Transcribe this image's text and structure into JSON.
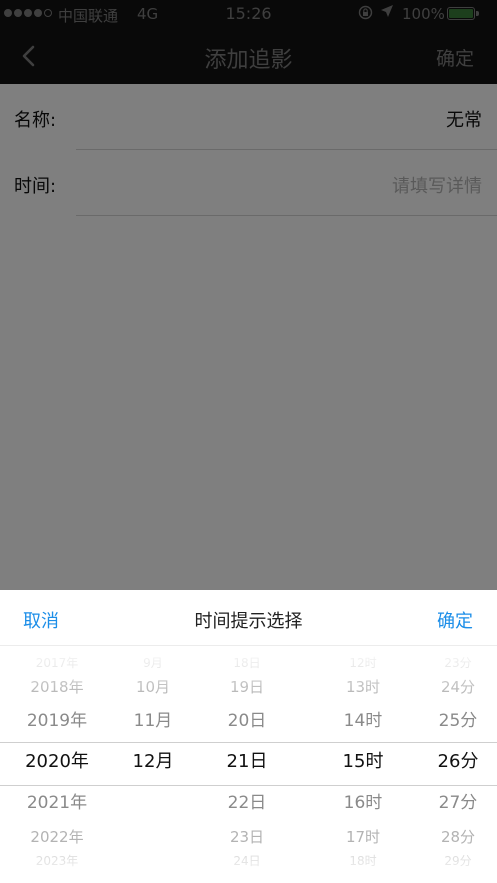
{
  "status_bar": {
    "carrier": "中国联通",
    "network": "4G",
    "time": "15:26",
    "battery": "100%",
    "signal_dots": [
      1,
      1,
      1,
      1,
      0
    ],
    "icons": [
      "lock-rotation-icon",
      "location-arrow-icon",
      "battery-icon"
    ]
  },
  "nav": {
    "back_icon": "chevron-left-icon",
    "title": "添加追影",
    "confirm": "确定"
  },
  "form": {
    "rows": [
      {
        "label": "名称:",
        "value": "无常"
      },
      {
        "label": "时间:",
        "placeholder": "请填写详情"
      }
    ]
  },
  "picker": {
    "cancel": "取消",
    "title": "时间提示选择",
    "confirm": "确定",
    "accent_color": "#1c8ee8",
    "columns": [
      {
        "name": "year",
        "items": [
          "2017年",
          "2018年",
          "2019年",
          "2020年",
          "2021年",
          "2022年",
          "2023年"
        ],
        "selected": 3
      },
      {
        "name": "month",
        "items": [
          "9月",
          "10月",
          "11月",
          "12月"
        ],
        "selected": 3
      },
      {
        "name": "day",
        "items": [
          "18日",
          "19日",
          "20日",
          "21日",
          "22日",
          "23日",
          "24日"
        ],
        "selected": 3
      },
      {
        "name": "hour",
        "items": [
          "12时",
          "13时",
          "14时",
          "15时",
          "16时",
          "17时",
          "18时"
        ],
        "selected": 3
      },
      {
        "name": "minute",
        "items": [
          "23分",
          "24分",
          "25分",
          "26分",
          "27分",
          "28分",
          "29分"
        ],
        "selected": 3
      }
    ]
  }
}
